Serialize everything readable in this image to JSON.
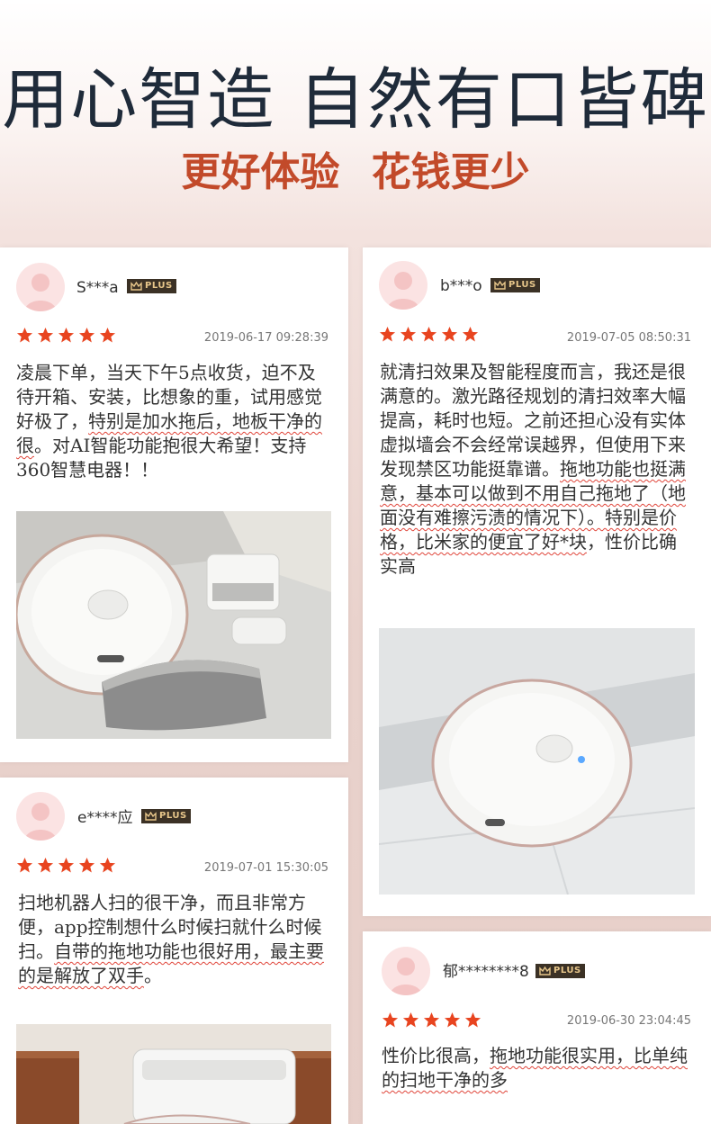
{
  "header": {
    "title": "用心智造 自然有口皆碑",
    "subtitle": "更好体验  花钱更少"
  },
  "colors": {
    "title": "#1f2b3a",
    "subtitle": "#c24a2a",
    "star": "#e8441f",
    "plus_bg": "#3b3125",
    "plus_text": "#e7c68a",
    "underline": "#e0453a"
  },
  "badge_label": "PLUS",
  "reviews": [
    {
      "user": "S***a",
      "date": "2019-06-17 09:28:39",
      "rating": 5,
      "text_plain": "凌晨下单，当天下午5点收货，迫不及待开箱、安装，比想象的重，试用感觉好极了，",
      "text_marked": "特别是加水拖后，地板干净的很",
      "text_tail": "。对AI智能功能抱很大希望！支持360智慧电器！！",
      "photo": "robot-vacuum-unboxed-photo"
    },
    {
      "user": "b***o",
      "date": "2019-07-05 08:50:31",
      "rating": 5,
      "text_plain": "就清扫效果及智能程度而言，我还是很满意的。激光路径规划的清扫效率大幅提高，耗时也短。之前还担心没有实体虚拟墙会不会经常误越界，但使用下来发现禁区功能挺靠谱。",
      "text_marked": "拖地功能也挺满意，基本可以做到不用自己拖地了（地面没有难擦污渍的情况下）。特别是价格，比米家的便宜了好*块",
      "text_tail": "，性价比确实高",
      "photo": "robot-vacuum-floor-photo"
    },
    {
      "user": "e****应",
      "date": "2019-07-01 15:30:05",
      "rating": 5,
      "text_plain": "扫地机器人扫的很干净，而且非常方便，app控制想什么时候扫就什么时候扫。",
      "text_marked": "自带的拖地功能也很好用，最主要的是解放了双手",
      "text_tail": "。",
      "photo": "robot-vacuum-dock-photo"
    },
    {
      "user": "郁********8",
      "date": "2019-06-30 23:04:45",
      "rating": 5,
      "text_plain": "性价比很高，",
      "text_marked": "拖地功能很实用，比单纯的扫地干净的多",
      "text_tail": "",
      "photo": ""
    }
  ]
}
